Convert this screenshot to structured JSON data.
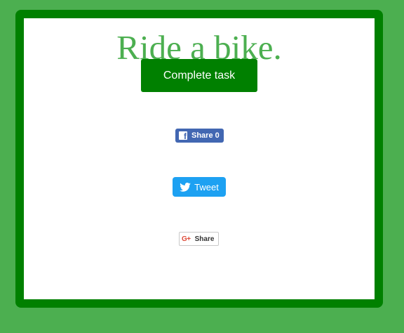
{
  "task": {
    "title": "Ride a bike.",
    "complete_label": "Complete task"
  },
  "share": {
    "facebook": {
      "icon": "facebook-icon",
      "label": "Share",
      "count": "0",
      "color": "#4267b2"
    },
    "twitter": {
      "icon": "twitter-bird-icon",
      "label": "Tweet",
      "color": "#1da1f2"
    },
    "google_plus": {
      "icon": "google-plus-icon",
      "label": "Share",
      "color": "#dd4b39"
    }
  },
  "colors": {
    "page_background": "#4caf50",
    "card_border": "#008000",
    "title_text": "#4caf50",
    "button_background": "#008000"
  }
}
